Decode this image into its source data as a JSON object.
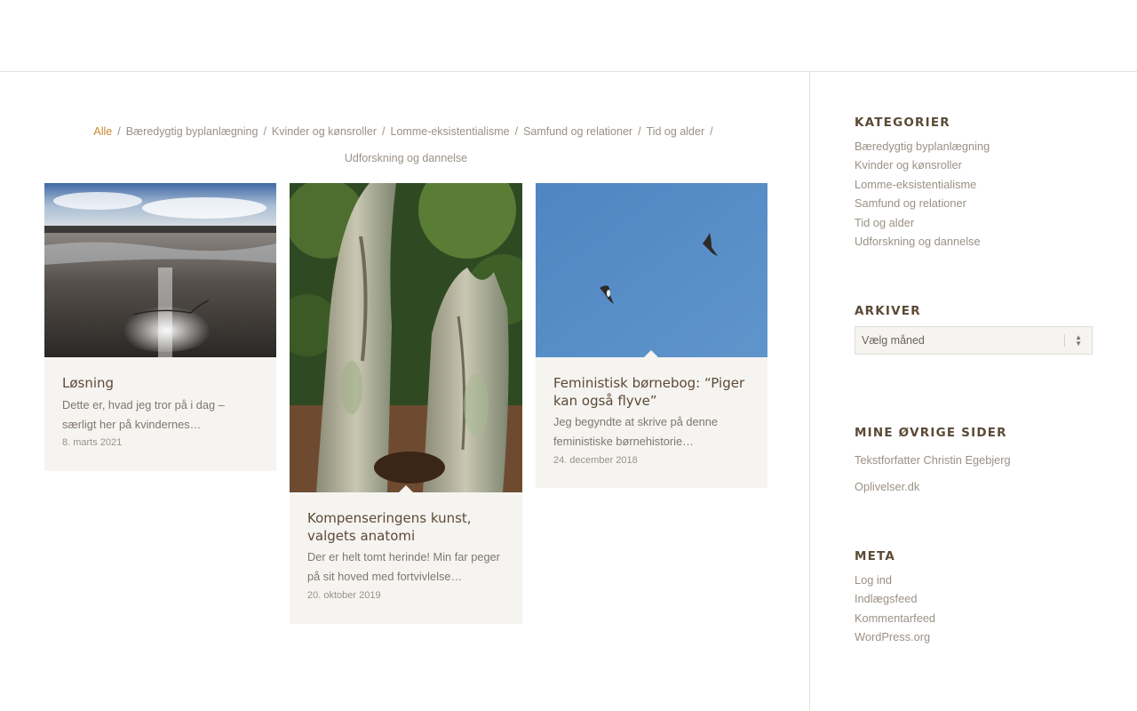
{
  "filters": {
    "items": [
      "Alle",
      "Bæredygtig byplanlægning",
      "Kvinder og kønsroller",
      "Lomme-eksistentialisme",
      "Samfund og relationer",
      "Tid og alder",
      "Udforskning og dannelse"
    ],
    "active_index": 0,
    "separator": "/"
  },
  "posts": [
    {
      "title": "Løsning",
      "excerpt": "Dette er, hvad jeg tror på i dag – særligt her på kvindernes…",
      "date": "8. marts 2021"
    },
    {
      "title": "Kompenseringens kunst, valgets anatomi",
      "excerpt": "Der er helt tomt herinde! Min far peger på sit hoved med fortvivlelse…",
      "date": "20. oktober 2019"
    },
    {
      "title": "Feministisk børnebog: “Piger kan også flyve”",
      "excerpt": "Jeg begyndte at skrive på denne feministiske børnehistorie…",
      "date": "24. december 2018"
    }
  ],
  "sidebar": {
    "categories": {
      "title": "KATEGORIER",
      "items": [
        "Bæredygtig byplanlægning",
        "Kvinder og kønsroller",
        "Lomme-eksistentialisme",
        "Samfund og relationer",
        "Tid og alder",
        "Udforskning og dannelse"
      ]
    },
    "archives": {
      "title": "ARKIVER",
      "select_value": "Vælg måned"
    },
    "other_sites": {
      "title": "MINE ØVRIGE SIDER",
      "items": [
        "Tekstforfatter Christin Egebjerg",
        "Oplivelser.dk"
      ]
    },
    "meta": {
      "title": "META",
      "items": [
        "Log ind",
        "Indlægsfeed",
        "Kommentarfeed",
        "WordPress.org"
      ]
    }
  },
  "colors": {
    "accent": "#c9882d",
    "heading": "#5b4a36",
    "card_bg": "#f6f4f1",
    "text": "#9a9187"
  }
}
